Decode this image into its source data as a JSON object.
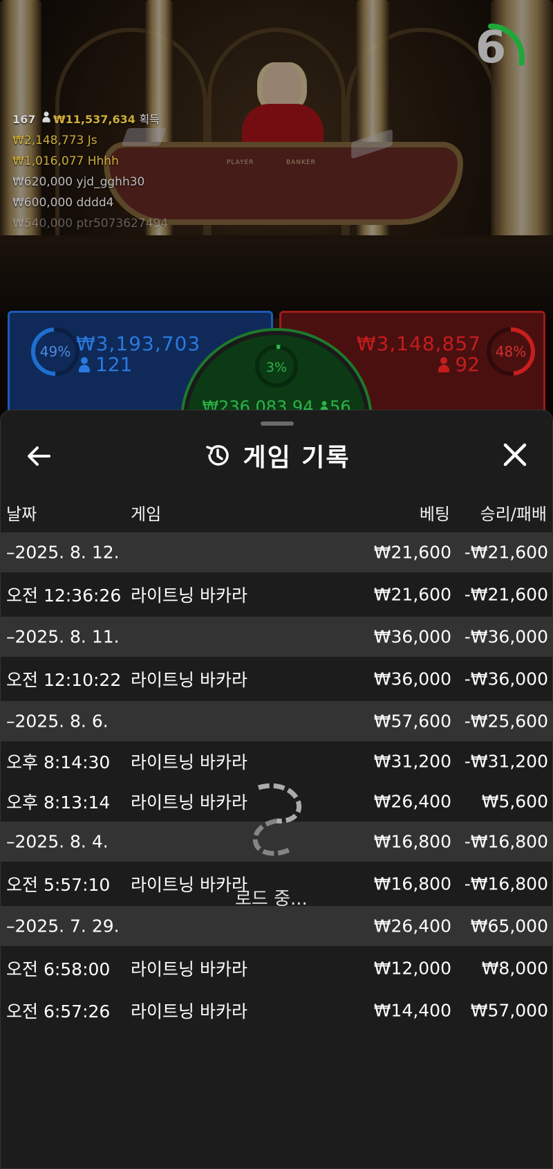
{
  "stage": {
    "table_labels": [
      "PLAYER",
      "BANKER"
    ],
    "timer": {
      "value": "6",
      "progress": 0.28,
      "color": "#1fa83a"
    }
  },
  "chat": {
    "summary_count": "167",
    "summary_amount": "₩11,537,634",
    "summary_suffix": "획득",
    "rows": [
      {
        "amount": "₩2,148,773",
        "name": "Js"
      },
      {
        "amount": "₩1,016,077",
        "name": "Hhhh"
      },
      {
        "amount": "₩620,000",
        "name": "yjd_gghh30"
      },
      {
        "amount": "₩600,000",
        "name": "dddd4"
      },
      {
        "amount": "₩540,000",
        "name": "ptr5073627494"
      }
    ]
  },
  "bets": {
    "player": {
      "percent": "49%",
      "amount": "₩3,193,703",
      "players": "121",
      "percent_value": 0.49,
      "color": "#1e6fd0"
    },
    "banker": {
      "percent": "48%",
      "amount": "₩3,148,857",
      "players": "92",
      "percent_value": 0.48,
      "color": "#c81e1e"
    },
    "tie": {
      "percent": "3%",
      "amount": "₩236,083.94",
      "players": "56",
      "percent_value": 0.03,
      "color": "#2db34a"
    }
  },
  "history": {
    "title": "게임 기록",
    "columns": {
      "date": "날짜",
      "game": "게임",
      "bet": "베팅",
      "win_loss": "승리/패배"
    },
    "rows": [
      {
        "type": "date",
        "date": "–2025. 8. 12.",
        "game": "",
        "bet": "₩21,600",
        "result": "-₩21,600"
      },
      {
        "type": "game",
        "date": "오전 12:36:26",
        "game": "라이트닝 바카라",
        "bet": "₩21,600",
        "result": "-₩21,600"
      },
      {
        "type": "date",
        "date": "–2025. 8. 11.",
        "game": "",
        "bet": "₩36,000",
        "result": "-₩36,000"
      },
      {
        "type": "game",
        "date": "오전 12:10:22",
        "game": "라이트닝 바카라",
        "bet": "₩36,000",
        "result": "-₩36,000"
      },
      {
        "type": "date",
        "date": "–2025. 8. 6.",
        "game": "",
        "bet": "₩57,600",
        "result": "-₩25,600"
      },
      {
        "type": "game",
        "date": "오후 8:14:30",
        "game": "라이트닝 바카라",
        "bet": "₩31,200",
        "result": "-₩31,200"
      },
      {
        "type": "game",
        "date": "오후 8:13:14",
        "game": "라이트닝 바카라",
        "bet": "₩26,400",
        "result": "₩5,600"
      },
      {
        "type": "date",
        "date": "–2025. 8. 4.",
        "game": "",
        "bet": "₩16,800",
        "result": "-₩16,800"
      },
      {
        "type": "game",
        "date": "오전 5:57:10",
        "game": "라이트닝 바카라",
        "bet": "₩16,800",
        "result": "-₩16,800"
      },
      {
        "type": "date",
        "date": "–2025. 7. 29.",
        "game": "",
        "bet": "₩26,400",
        "result": "₩65,000"
      },
      {
        "type": "game",
        "date": "오전 6:58:00",
        "game": "라이트닝 바카라",
        "bet": "₩12,000",
        "result": "₩8,000"
      },
      {
        "type": "game",
        "date": "오전 6:57:26",
        "game": "라이트닝 바카라",
        "bet": "₩14,400",
        "result": "₩57,000"
      }
    ],
    "loading_text": "로드 중..."
  },
  "icons": {
    "back": "arrow-left-icon",
    "history": "history-icon",
    "close": "close-icon",
    "loader": "spinner-icon",
    "person": "person-icon"
  }
}
